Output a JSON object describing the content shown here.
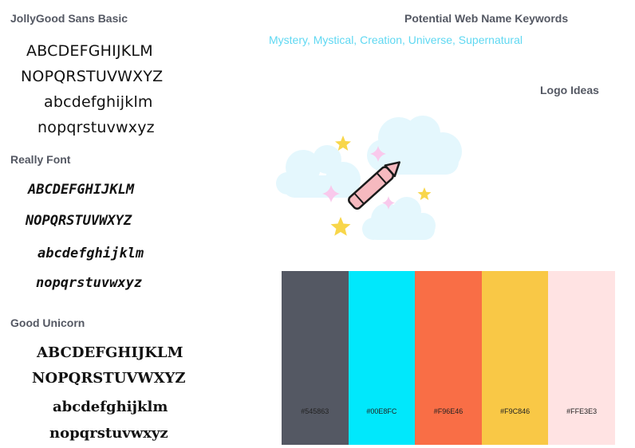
{
  "fonts": [
    {
      "heading": "JollyGood Sans Basic",
      "samples": [
        "ABCDEFGHIJKLM",
        "NOPQRSTUVWXYZ",
        "abcdefghijklm",
        "nopqrstuvwxyz"
      ]
    },
    {
      "heading": "Really Font",
      "samples": [
        "ABCDEFGHIJKLM",
        "NOPQRSTUVWXYZ",
        "abcdefghijklm",
        "nopqrstuvwxyz"
      ]
    },
    {
      "heading": "Good Unicorn",
      "samples": [
        "ABCDEFGHIJKLM",
        "NOPQRSTUVWXYZ",
        "abcdefghijklm",
        "nopqrstuvwxyz"
      ]
    }
  ],
  "keywords": {
    "heading": "Potential Web Name Keywords",
    "text": "Mystery, Mystical, Creation, Universe, Supernatural"
  },
  "logo": {
    "heading": "Logo Ideas",
    "icons": [
      "cloud-icon",
      "crayon-icon",
      "star-icon",
      "sparkle-icon"
    ]
  },
  "palette": [
    {
      "hex": "#545863",
      "label": "#545863"
    },
    {
      "hex": "#00E8FC",
      "label": "#00E8FC"
    },
    {
      "hex": "#F96E46",
      "label": "#F96E46"
    },
    {
      "hex": "#F9C846",
      "label": "#F9C846"
    },
    {
      "hex": "#FFE3E3",
      "label": "#FFE3E3"
    }
  ]
}
